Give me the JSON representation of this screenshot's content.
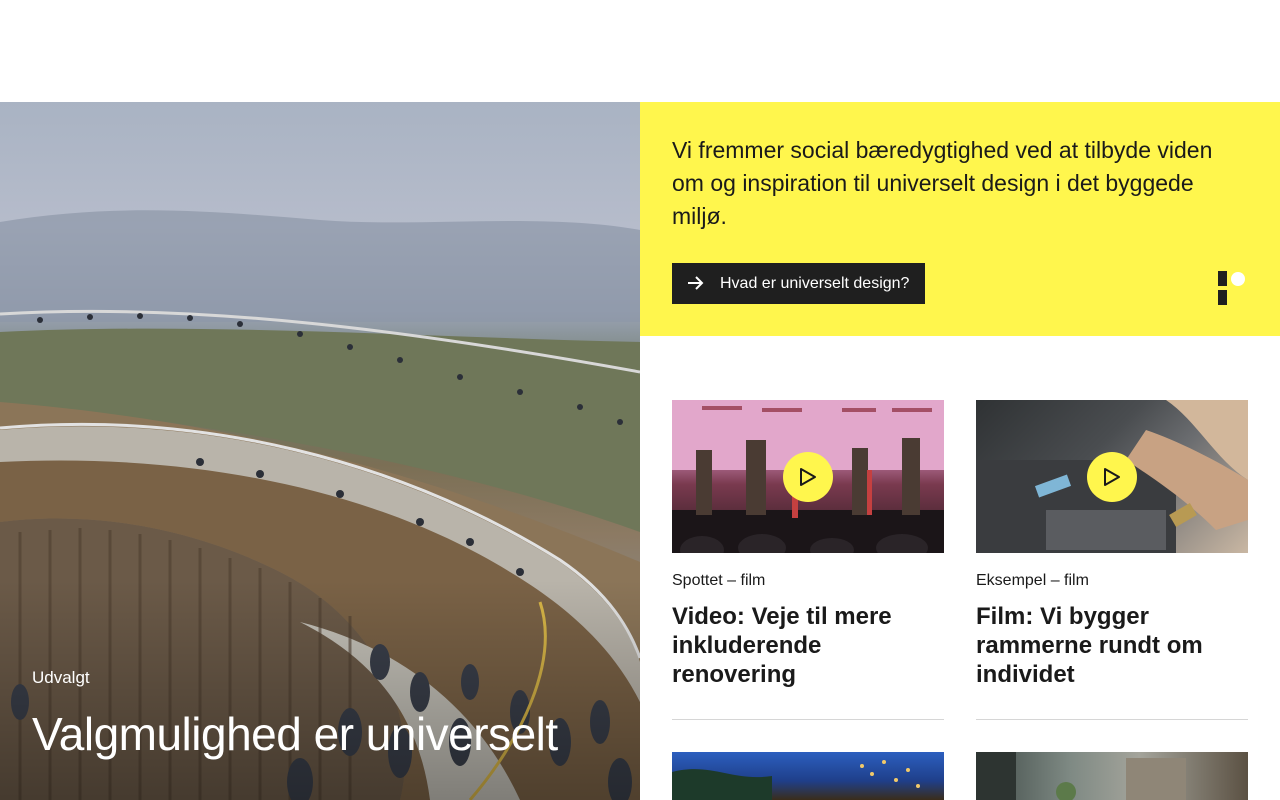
{
  "hero": {
    "tag": "Udvalgt",
    "title": "Valgmulighed er universelt"
  },
  "mission": {
    "text": "Vi fremmer social bæredygtighed ved at tilbyde viden om og inspiration til universelt design i det byggede miljø.",
    "button_label": "Hvad er universelt design?",
    "colors": {
      "accent": "#fff64d",
      "button_bg": "#1f1f1f"
    }
  },
  "cards": [
    {
      "meta": "Spottet – film",
      "title": "Video: Veje til mere inkluderende renovering"
    },
    {
      "meta": "Eksempel – film",
      "title": "Film: Vi bygger rammerne rundt om individet"
    }
  ],
  "icons": {
    "button": "arrow-right-icon",
    "brand": "logo-mark-icon",
    "play": "play-icon"
  }
}
